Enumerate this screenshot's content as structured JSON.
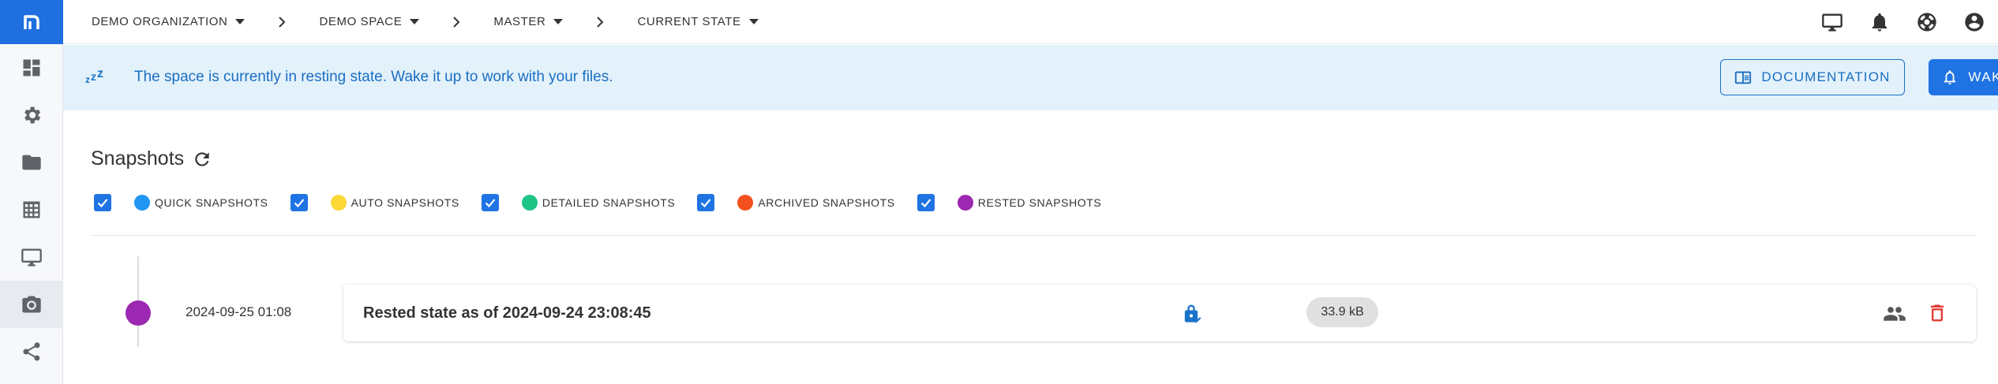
{
  "app": {
    "logo_text": "n"
  },
  "sidebar": {
    "items": [
      {
        "name": "dashboard-icon"
      },
      {
        "name": "settings-icon"
      },
      {
        "name": "folder-icon"
      },
      {
        "name": "table-icon"
      },
      {
        "name": "monitor-icon"
      },
      {
        "name": "camera-icon",
        "active": true
      },
      {
        "name": "share-icon"
      }
    ]
  },
  "breadcrumb": [
    {
      "label": "DEMO ORGANIZATION"
    },
    {
      "label": "DEMO SPACE"
    },
    {
      "label": "MASTER"
    },
    {
      "label": "CURRENT STATE"
    }
  ],
  "topbar_icons": [
    "monitor-icon",
    "bell-icon",
    "support-icon",
    "account-icon"
  ],
  "banner": {
    "zzz": "zzz",
    "message": "The space is currently in resting state. Wake it up to work with your files.",
    "documentation_label": "DOCUMENTATION",
    "wake_up_label": "WAKE UP",
    "accent_color": "#1a6fc2",
    "background_color": "#e3f1fb"
  },
  "snapshots": {
    "title": "Snapshots",
    "filters": [
      {
        "label": "QUICK SNAPSHOTS",
        "color": "#2196f3",
        "checked": true
      },
      {
        "label": "AUTO SNAPSHOTS",
        "color": "#fdd835",
        "checked": true
      },
      {
        "label": "DETAILED SNAPSHOTS",
        "color": "#1ec486",
        "checked": true
      },
      {
        "label": "ARCHIVED SNAPSHOTS",
        "color": "#f4511e",
        "checked": true
      },
      {
        "label": "RESTED SNAPSHOTS",
        "color": "#9c27b0",
        "checked": true
      }
    ],
    "entries": [
      {
        "date": "2024-09-25 01:08",
        "title": "Rested state as of 2024-09-24 23:08:45",
        "size": "33.9 kB",
        "dot_color": "#9c27b0"
      }
    ]
  }
}
